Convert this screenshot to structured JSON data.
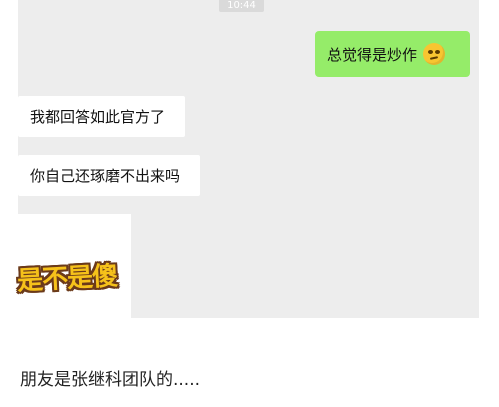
{
  "status": {
    "time": "10:44"
  },
  "messages": [
    {
      "side": "right",
      "text": "总觉得是炒作",
      "emoji": "thinking-face"
    },
    {
      "side": "left",
      "text": "我都回答如此官方了"
    },
    {
      "side": "left",
      "text": "你自己还琢磨不出来吗"
    },
    {
      "side": "left",
      "sticker_text": "是不是傻"
    }
  ],
  "caption": "朋友是张继科团队的.....",
  "colors": {
    "chat_bg": "#ededed",
    "self_bubble": "#95ec69",
    "other_bubble": "#ffffff"
  }
}
